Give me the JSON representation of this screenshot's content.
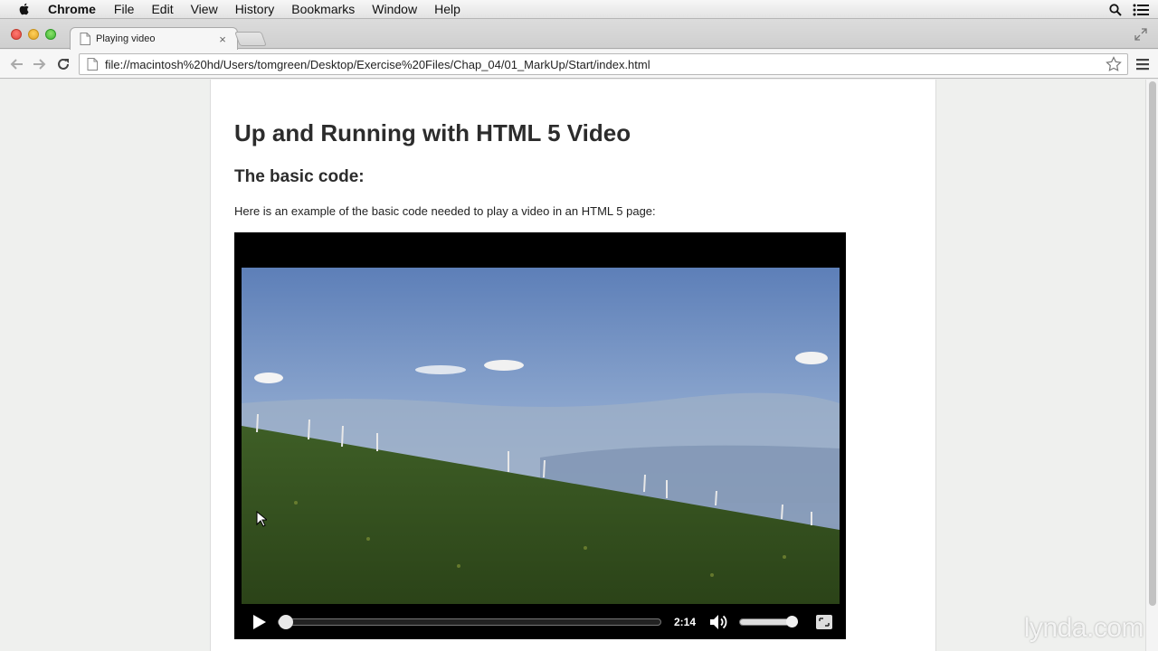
{
  "menubar": {
    "app_name": "Chrome",
    "items": [
      "File",
      "Edit",
      "View",
      "History",
      "Bookmarks",
      "Window",
      "Help"
    ]
  },
  "tab": {
    "title": "Playing video",
    "close_glyph": "×"
  },
  "toolbar": {
    "url": "file://macintosh%20hd/Users/tomgreen/Desktop/Exercise%20Files/Chap_04/01_MarkUp/Start/index.html"
  },
  "page": {
    "title": "Up and Running with HTML 5 Video",
    "subtitle": "The basic code:",
    "intro": "Here is an example of the basic code needed to play a video in an HTML 5 page:"
  },
  "video": {
    "time_label": "2:14",
    "progress_percent": 0,
    "volume_percent": 100
  },
  "watermark": "lynda.com",
  "colors": {
    "accent_red": "#e0443e",
    "accent_yellow": "#dfa123",
    "accent_green": "#3eb233"
  }
}
